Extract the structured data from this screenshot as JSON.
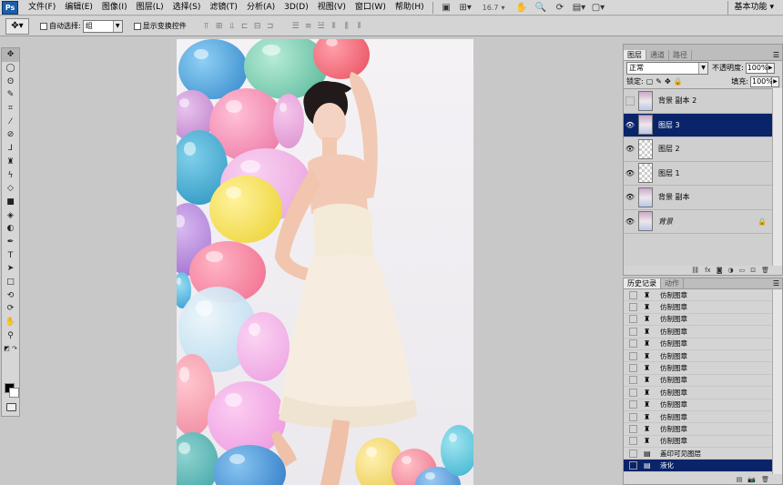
{
  "menubar": {
    "app_logo": "Ps",
    "items": [
      "文件(F)",
      "编辑(E)",
      "图像(I)",
      "图层(L)",
      "选择(S)",
      "滤镜(T)",
      "分析(A)",
      "3D(D)",
      "视图(V)",
      "窗口(W)",
      "帮助(H)"
    ],
    "zoom": "16.7",
    "workspace": "基本功能"
  },
  "options": {
    "auto_select_label": "自动选择:",
    "auto_select_value": "组",
    "show_transform_label": "显示变换控件"
  },
  "layers_panel": {
    "tabs": [
      "图层",
      "通道",
      "路径"
    ],
    "blend_mode": "正常",
    "opacity_label": "不透明度:",
    "opacity_value": "100%",
    "lock_label": "锁定:",
    "fill_label": "填充:",
    "fill_value": "100%",
    "layers": [
      {
        "name": "背景 副本 2",
        "visible": false,
        "thumb": "photo",
        "selected": false,
        "italic": false
      },
      {
        "name": "图层 3",
        "visible": true,
        "thumb": "photo",
        "selected": true,
        "italic": false
      },
      {
        "name": "图层 2",
        "visible": true,
        "thumb": "check",
        "selected": false,
        "italic": false
      },
      {
        "name": "图层 1",
        "visible": true,
        "thumb": "check",
        "selected": false,
        "italic": false
      },
      {
        "name": "背景 副本",
        "visible": true,
        "thumb": "photo",
        "selected": false,
        "italic": false
      },
      {
        "name": "背景",
        "visible": true,
        "thumb": "photo",
        "selected": false,
        "italic": true
      }
    ]
  },
  "history_panel": {
    "tabs": [
      "历史记录",
      "动作"
    ],
    "items": [
      {
        "label": "仿制图章",
        "icon": "stamp-icon"
      },
      {
        "label": "仿制图章",
        "icon": "stamp-icon"
      },
      {
        "label": "仿制图章",
        "icon": "stamp-icon"
      },
      {
        "label": "仿制图章",
        "icon": "stamp-icon"
      },
      {
        "label": "仿制图章",
        "icon": "stamp-icon"
      },
      {
        "label": "仿制图章",
        "icon": "stamp-icon"
      },
      {
        "label": "仿制图章",
        "icon": "stamp-icon"
      },
      {
        "label": "仿制图章",
        "icon": "stamp-icon"
      },
      {
        "label": "仿制图章",
        "icon": "stamp-icon"
      },
      {
        "label": "仿制图章",
        "icon": "stamp-icon"
      },
      {
        "label": "仿制图章",
        "icon": "stamp-icon"
      },
      {
        "label": "仿制图章",
        "icon": "stamp-icon"
      },
      {
        "label": "仿制图章",
        "icon": "stamp-icon"
      },
      {
        "label": "盖印可见图层",
        "icon": "document-icon"
      },
      {
        "label": "液化",
        "icon": "document-icon"
      }
    ],
    "selected_index": 14
  },
  "colors": {
    "selection": "#0a246a",
    "foreground": "#000000",
    "background": "#ffffff"
  }
}
